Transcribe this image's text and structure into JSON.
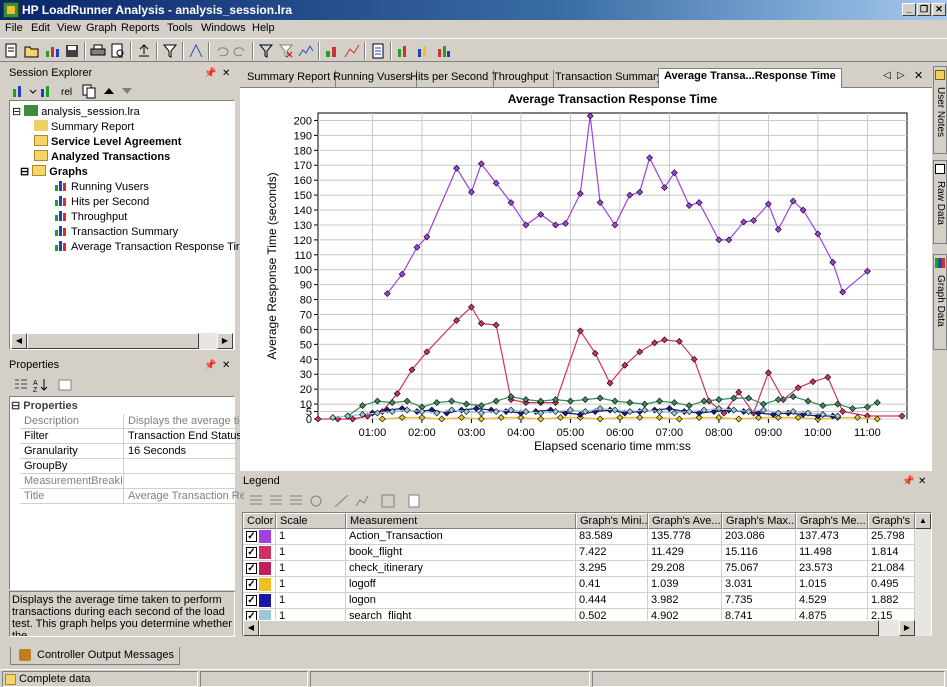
{
  "window": {
    "title": "HP LoadRunner Analysis - analysis_session.lra"
  },
  "menu": [
    "File",
    "Edit",
    "View",
    "Graph",
    "Reports",
    "Tools",
    "Windows",
    "Help"
  ],
  "session_explorer": {
    "title": "Session Explorer",
    "tree": {
      "root": "analysis_session.lra",
      "summary": "Summary Report",
      "sla": "Service Level Agreement",
      "analyzed": "Analyzed Transactions",
      "graphs": "Graphs",
      "graph_items": [
        "Running Vusers",
        "Hits per Second",
        "Throughput",
        "Transaction Summary",
        "Average Transaction Response Tir"
      ]
    }
  },
  "properties": {
    "title": "Properties",
    "section": "Properties",
    "rows": [
      {
        "key": "Description",
        "value": "Displays the average time t"
      },
      {
        "key": "Filter",
        "value": "Transaction End Status = ("
      },
      {
        "key": "Granularity",
        "value": "16 Seconds"
      },
      {
        "key": "GroupBy",
        "value": ""
      },
      {
        "key": "MeasurementBreakI",
        "value": ""
      },
      {
        "key": "Title",
        "value": "Average Transaction Resp"
      }
    ],
    "description": "Displays the average time taken to perform transactions during each second of the load test. This graph helps you determine whether the"
  },
  "tabs": [
    "Summary Report",
    "Running Vusers",
    "Hits per Second",
    "Throughput",
    "Transaction Summary",
    "Average Transa...Response Time"
  ],
  "side_tabs": [
    "User Notes",
    "Raw Data",
    "Graph Data"
  ],
  "chart_data": {
    "type": "line",
    "title": "Average Transaction Response Time",
    "xlabel": "Elapsed scenario time mm:ss",
    "ylabel": "Average Response Time (seconds)",
    "ylim": [
      0,
      205
    ],
    "xlim": [
      -0.1,
      11.8
    ],
    "y_ticks": [
      0,
      5,
      10,
      20,
      30,
      40,
      50,
      60,
      70,
      80,
      90,
      100,
      110,
      120,
      130,
      140,
      150,
      160,
      170,
      180,
      190,
      200
    ],
    "x_ticks": [
      "01:00",
      "02:00",
      "03:00",
      "04:00",
      "05:00",
      "06:00",
      "07:00",
      "08:00",
      "09:00",
      "10:00",
      "11:00"
    ],
    "grid": true,
    "series": [
      {
        "name": "Action_Transaction",
        "color": "#a040e0",
        "x": [
          1.3,
          1.6,
          1.9,
          2.1,
          2.7,
          3.0,
          3.2,
          3.5,
          3.8,
          4.1,
          4.4,
          4.7,
          4.9,
          5.2,
          5.4,
          5.6,
          5.9,
          6.2,
          6.4,
          6.6,
          6.9,
          7.1,
          7.4,
          7.6,
          8.0,
          8.2,
          8.5,
          8.7,
          9.0,
          9.2,
          9.5,
          9.7,
          10.0,
          10.3,
          10.5,
          11.0
        ],
        "y": [
          84,
          97,
          115,
          122,
          168,
          152,
          171,
          158,
          145,
          130,
          137,
          130,
          131,
          151,
          203,
          145,
          130,
          150,
          152,
          175,
          155,
          165,
          143,
          145,
          120,
          120,
          132,
          133,
          144,
          127,
          146,
          140,
          124,
          105,
          85,
          99
        ]
      },
      {
        "name": "book_flight",
        "color": "#d03060",
        "x": [
          -0.1,
          0.3,
          0.6,
          0.9,
          1.2,
          1.5,
          1.8,
          2.1,
          2.7,
          3.0,
          3.2,
          3.5,
          3.8,
          4.1,
          4.4,
          4.7,
          5.2,
          5.5,
          5.8,
          6.1,
          6.4,
          6.7,
          6.9,
          7.2,
          7.5,
          7.8,
          8.1,
          8.4,
          8.7,
          9.0,
          9.3,
          9.6,
          9.9,
          10.2,
          10.5,
          11.0,
          11.7
        ],
        "y": [
          0,
          0,
          0,
          2,
          5,
          17,
          33,
          45,
          66,
          75,
          64,
          63,
          13,
          11,
          11,
          11,
          59,
          44,
          24,
          36,
          45,
          51,
          53,
          52,
          40,
          12,
          4,
          18,
          4,
          31,
          13,
          21,
          25,
          28,
          5,
          2,
          2
        ]
      },
      {
        "name": "check_itinerary",
        "color": "#3a8a5a",
        "x": [
          0.5,
          0.8,
          1.1,
          1.4,
          1.7,
          2.0,
          2.3,
          2.6,
          2.9,
          3.2,
          3.5,
          3.8,
          4.1,
          4.4,
          4.7,
          5.0,
          5.3,
          5.6,
          5.9,
          6.2,
          6.5,
          6.8,
          7.1,
          7.4,
          7.7,
          8.0,
          8.3,
          8.6,
          8.9,
          9.2,
          9.5,
          9.8,
          10.1,
          10.4,
          10.7,
          11.0,
          11.2
        ],
        "y": [
          2,
          9,
          12,
          11,
          12,
          8,
          11,
          12,
          10,
          9,
          12,
          15,
          13,
          12,
          13,
          12,
          13,
          14,
          12,
          11,
          10,
          12,
          11,
          9,
          12,
          13,
          14,
          14,
          10,
          13,
          15,
          12,
          9,
          10,
          7,
          8,
          11
        ]
      },
      {
        "name": "logoff",
        "color": "#f0c020",
        "x": [
          1.2,
          1.6,
          2.0,
          2.4,
          2.8,
          3.2,
          3.6,
          4.0,
          4.4,
          4.8,
          5.2,
          5.6,
          6.0,
          6.4,
          6.8,
          7.2,
          7.6,
          8.0,
          8.4,
          8.8,
          9.2,
          9.6,
          10.0,
          10.4,
          10.8,
          11.2
        ],
        "y": [
          0,
          1,
          1,
          0,
          1,
          0,
          1,
          1,
          0,
          1,
          1,
          0,
          1,
          1,
          1,
          0,
          1,
          1,
          0,
          1,
          1,
          1,
          0,
          1,
          1,
          0
        ]
      },
      {
        "name": "logon",
        "color": "#1a1a8a",
        "x": [
          1.0,
          1.3,
          1.6,
          1.9,
          2.2,
          2.5,
          2.8,
          3.1,
          3.4,
          3.7,
          4.0,
          4.3,
          4.6,
          4.9,
          5.2,
          5.5,
          5.8,
          6.1,
          6.4,
          6.7,
          7.0,
          7.3,
          7.6,
          7.9,
          8.2,
          8.5,
          8.8,
          9.1,
          9.4,
          9.7,
          10.0,
          10.3
        ],
        "y": [
          4,
          6,
          7,
          5,
          6,
          4,
          6,
          7,
          6,
          5,
          4,
          5,
          6,
          4,
          3,
          5,
          6,
          4,
          5,
          6,
          7,
          5,
          4,
          5,
          6,
          5,
          4,
          3,
          4,
          3,
          2,
          2
        ]
      },
      {
        "name": "search_flight",
        "color": "#9ac8d8",
        "x": [
          0.2,
          0.5,
          0.8,
          1.1,
          1.4,
          1.7,
          2.0,
          2.3,
          2.6,
          2.9,
          3.2,
          3.5,
          3.8,
          4.1,
          4.4,
          4.7,
          5.0,
          5.3,
          5.6,
          5.9,
          6.2,
          6.5,
          6.8,
          7.1,
          7.4,
          7.7,
          8.0,
          8.3,
          8.6,
          8.9,
          9.2,
          9.5,
          9.8,
          10.1,
          10.4
        ],
        "y": [
          1,
          2,
          3,
          4,
          5,
          6,
          5,
          4,
          6,
          5,
          4,
          5,
          6,
          5,
          4,
          5,
          6,
          5,
          7,
          6,
          5,
          6,
          5,
          4,
          5,
          6,
          7,
          6,
          5,
          6,
          4,
          5,
          4,
          3,
          2
        ]
      }
    ]
  },
  "legend": {
    "title": "Legend",
    "columns": [
      "Color",
      "Scale",
      "Measurement",
      "Graph's Mini...",
      "Graph's Ave...",
      "Graph's Max...",
      "Graph's Me...",
      "Graph's S"
    ],
    "rows": [
      {
        "color": "#a040e0",
        "scale": "1",
        "measurement": "Action_Transaction",
        "min": "83.589",
        "avg": "135.778",
        "max": "203.086",
        "median": "137.473",
        "std": "25.798"
      },
      {
        "color": "#d03060",
        "scale": "1",
        "measurement": "book_flight",
        "min": "7.422",
        "avg": "11.429",
        "max": "15.116",
        "median": "11.498",
        "std": "1.814"
      },
      {
        "color": "#c02060",
        "scale": "1",
        "measurement": "check_itinerary",
        "min": "3.295",
        "avg": "29.208",
        "max": "75.067",
        "median": "23.573",
        "std": "21.084"
      },
      {
        "color": "#f0c020",
        "scale": "1",
        "measurement": "logoff",
        "min": "0.41",
        "avg": "1.039",
        "max": "3.031",
        "median": "1.015",
        "std": "0.495"
      },
      {
        "color": "#1a1aa0",
        "scale": "1",
        "measurement": "logon",
        "min": "0.444",
        "avg": "3.982",
        "max": "7.735",
        "median": "4.529",
        "std": "1.882"
      },
      {
        "color": "#9ac8d8",
        "scale": "1",
        "measurement": "search_flight",
        "min": "0.502",
        "avg": "4.902",
        "max": "8.741",
        "median": "4.875",
        "std": "2.15"
      }
    ]
  },
  "output_tab": "Controller Output Messages",
  "status": "Complete data"
}
